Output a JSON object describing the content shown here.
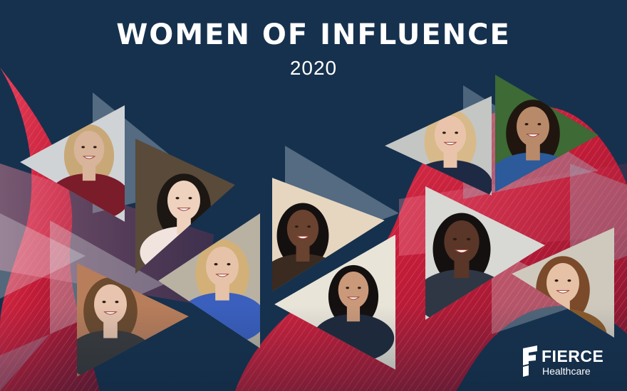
{
  "banner": {
    "title": "WOMEN OF INFLUENCE",
    "year": "2020"
  },
  "brand": {
    "name": "FIERCE",
    "sub": "Healthcare"
  },
  "portraits": [
    {
      "name": "portrait-1",
      "skin": "#d8b49a",
      "hair": "#c9a878",
      "top": "#7a1c2a",
      "bg": "#cfd3d6"
    },
    {
      "name": "portrait-2",
      "skin": "#efd2bd",
      "hair": "#1d1714",
      "top": "#f1e4de",
      "bg": "#5a4a3a"
    },
    {
      "name": "portrait-3",
      "skin": "#e6c3a8",
      "hair": "#d2b078",
      "top": "#3a5fbd",
      "bg": "#b9b2a2"
    },
    {
      "name": "portrait-4",
      "skin": "#e8c3ad",
      "hair": "#6b4a2e",
      "top": "#3a3a3a",
      "bg": "#b87d5a"
    },
    {
      "name": "portrait-5",
      "skin": "#6a4230",
      "hair": "#151010",
      "top": "#3a2a20",
      "bg": "#e6d6c0"
    },
    {
      "name": "portrait-6",
      "skin": "#c9997a",
      "hair": "#151010",
      "top": "#1f2a3a",
      "bg": "#e9e4d8"
    },
    {
      "name": "portrait-7",
      "skin": "#e9c4aa",
      "hair": "#d8b98a",
      "top": "#1e2a44",
      "bg": "#c4c6c4"
    },
    {
      "name": "portrait-8",
      "skin": "#b98a6a",
      "hair": "#20160f",
      "top": "#2c5a9a",
      "bg": "#3d6a35"
    },
    {
      "name": "portrait-9",
      "skin": "#5a3628",
      "hair": "#151010",
      "top": "#2f3744",
      "bg": "#d8d8d4"
    },
    {
      "name": "portrait-10",
      "skin": "#e7c1a6",
      "hair": "#7a4a2a",
      "top": "#8a5a2a",
      "bg": "#cfc9bd"
    }
  ],
  "colors": {
    "navy": "#16314d",
    "red": "#d21f3c",
    "pink": "#e8607a",
    "slate": "#6d8596"
  }
}
